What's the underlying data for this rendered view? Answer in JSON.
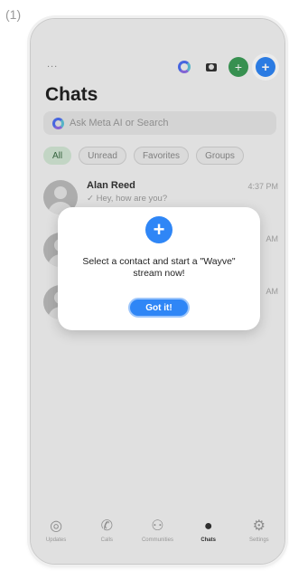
{
  "figure_label": "(1)",
  "header": {
    "more": "...",
    "title": "Chats"
  },
  "search": {
    "placeholder": "Ask Meta AI or Search"
  },
  "filters": [
    "All",
    "Unread",
    "Favorites",
    "Groups"
  ],
  "active_filter": "All",
  "chats": [
    {
      "name": "Alan Reed",
      "message": "✓ Hey, how are you?",
      "time": "4:37 PM"
    },
    {
      "name": "",
      "message": "",
      "time": "AM"
    },
    {
      "name": "",
      "message": "",
      "time": "AM"
    }
  ],
  "modal": {
    "text": "Select a contact and start a \"Wayve\" stream now!",
    "button": "Got it!"
  },
  "tabs": [
    {
      "label": "Updates",
      "icon": "updates-icon"
    },
    {
      "label": "Calls",
      "icon": "phone-icon"
    },
    {
      "label": "Communities",
      "icon": "communities-icon"
    },
    {
      "label": "Chats",
      "icon": "chat-bubble-icon"
    },
    {
      "label": "Settings",
      "icon": "settings-icon"
    }
  ],
  "active_tab": "Chats",
  "colors": {
    "accent": "#2f86f6",
    "green": "#3c9d57",
    "active_chip_bg": "#d3e8d5"
  }
}
